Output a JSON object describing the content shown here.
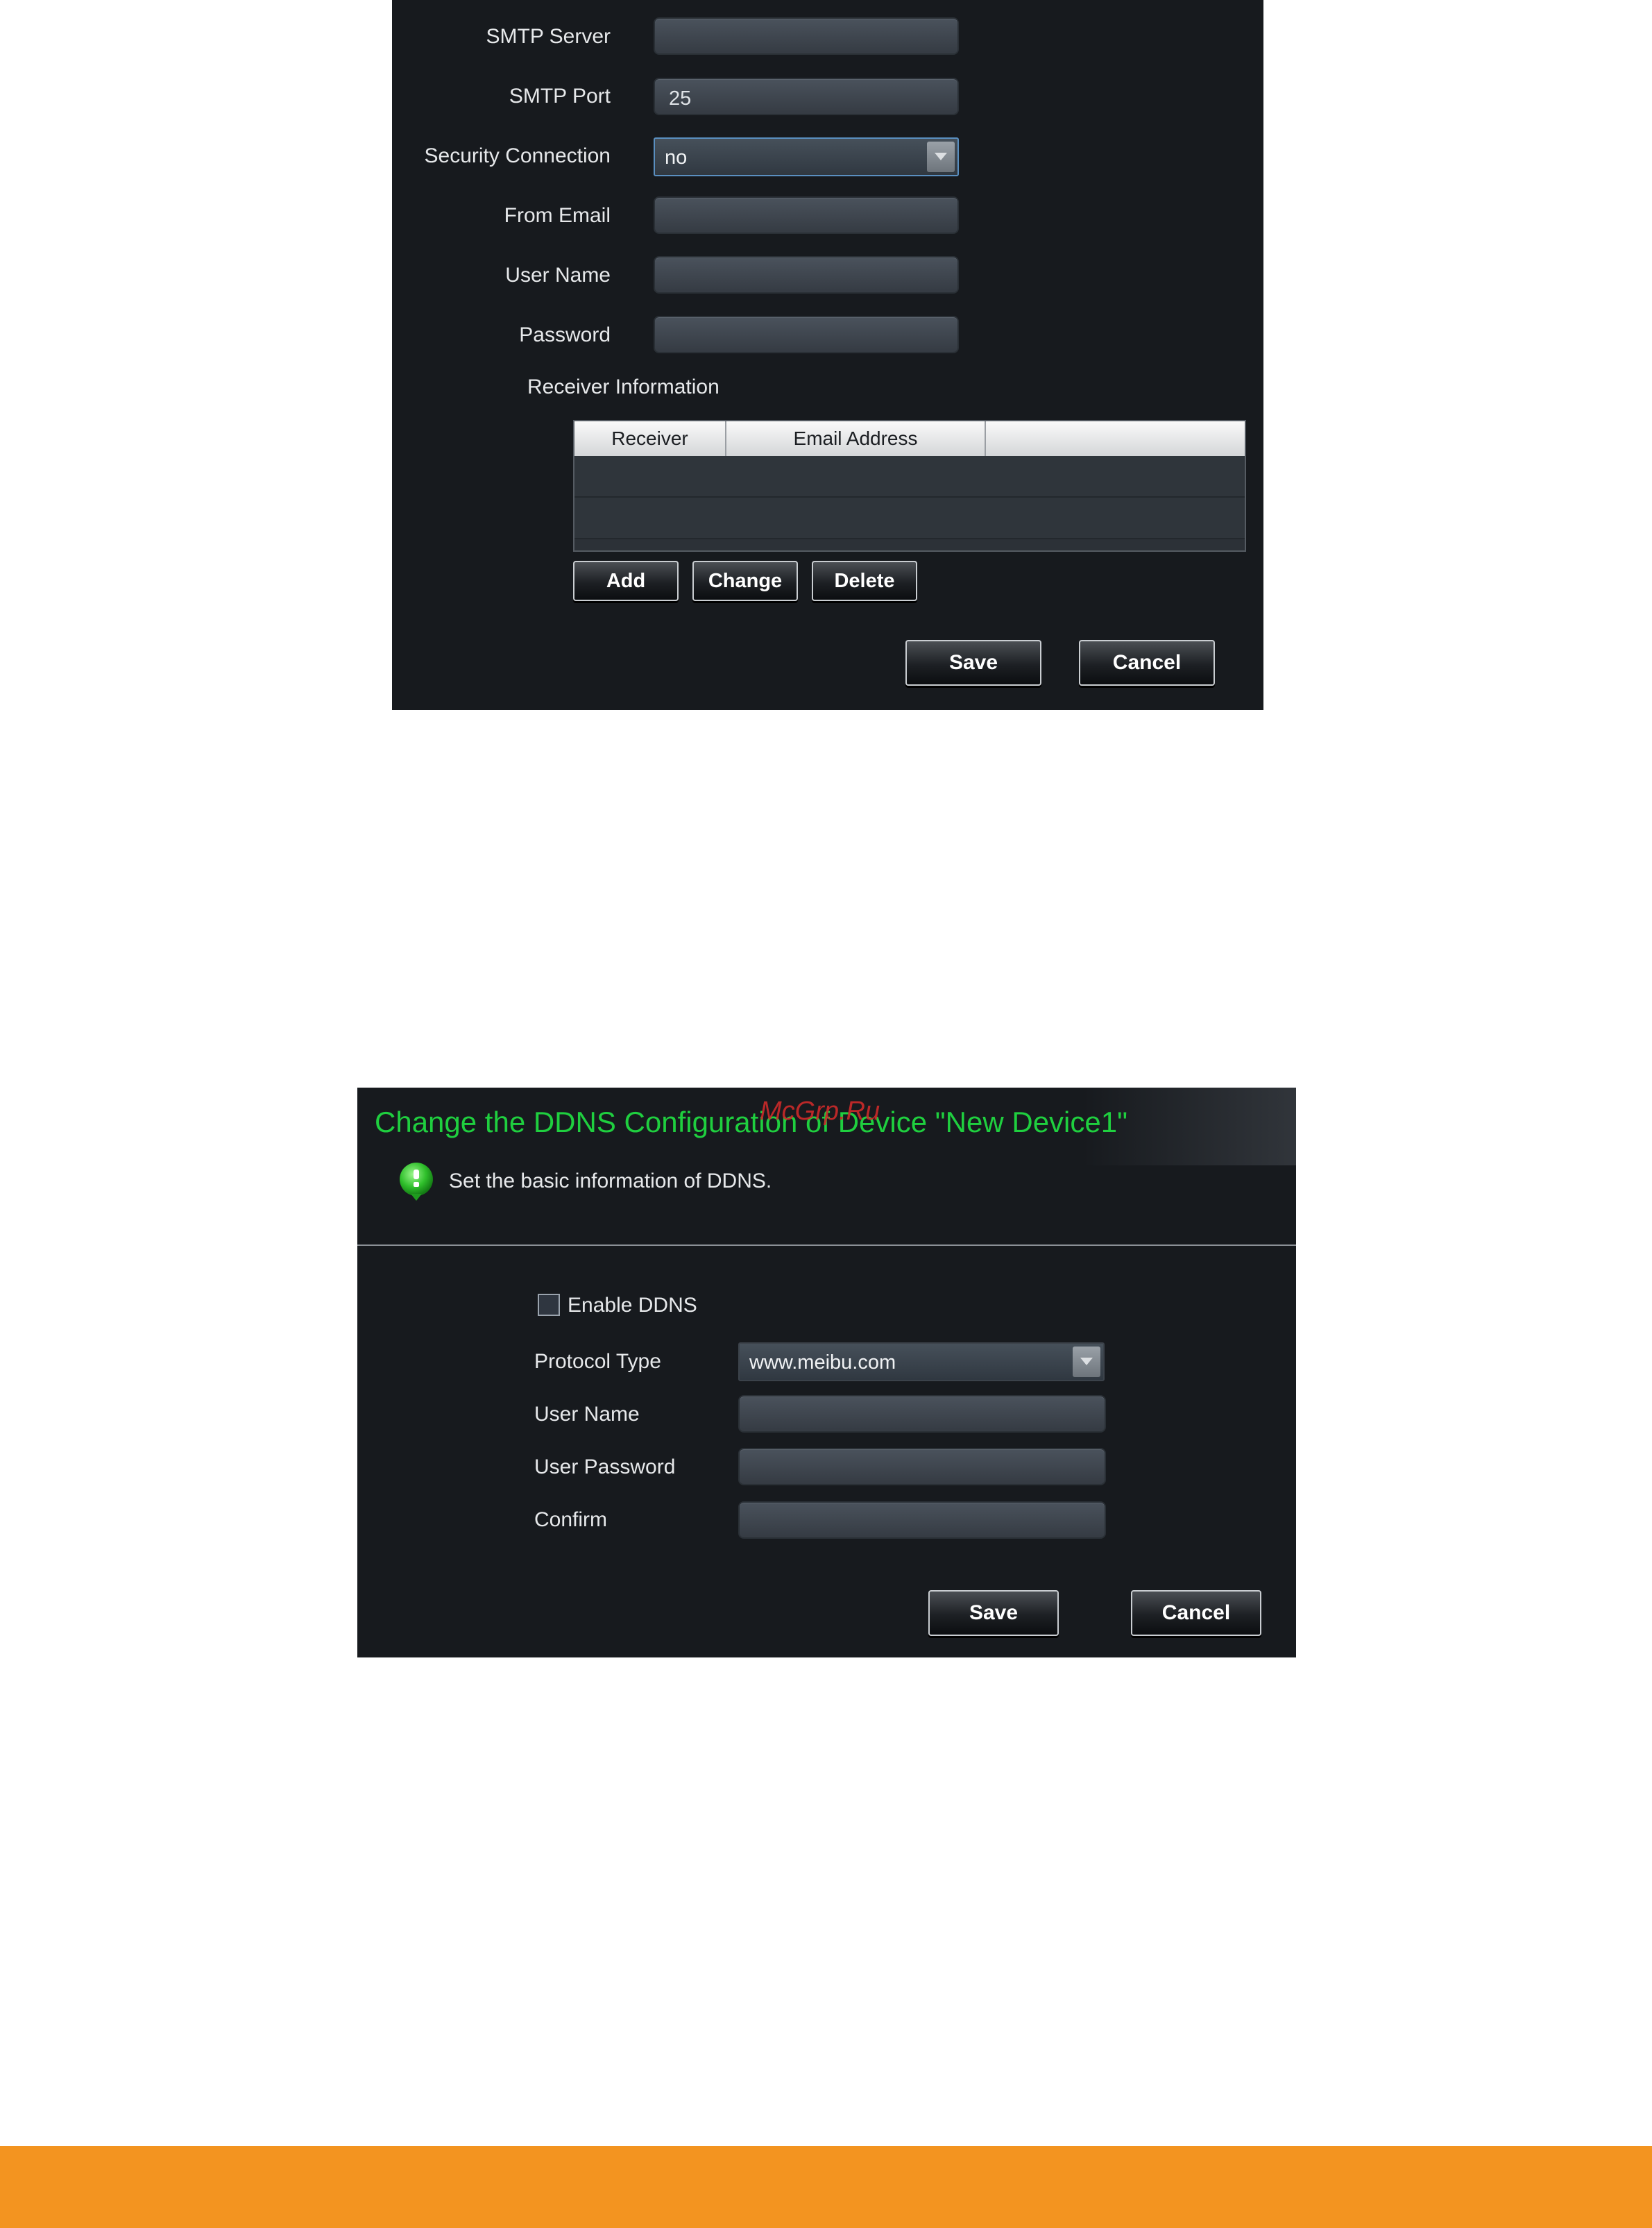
{
  "smtp": {
    "server_label": "SMTP Server",
    "server_value": "",
    "port_label": "SMTP Port",
    "port_value": "25",
    "security_label": "Security Connection",
    "security_value": "no",
    "from_label": "From Email",
    "from_value": "",
    "user_label": "User Name",
    "user_value": "",
    "password_label": "Password",
    "password_value": "",
    "receiver_info_label": "Receiver Information",
    "table": {
      "columns": [
        "Receiver",
        "Email Address",
        ""
      ],
      "rows": []
    },
    "add_label": "Add",
    "change_label": "Change",
    "delete_label": "Delete",
    "save_label": "Save",
    "cancel_label": "Cancel"
  },
  "ddns": {
    "title": "Change the DDNS Configuration of Device \"New Device1\"",
    "watermark": "McGrp.Ru",
    "subtitle": "Set the basic information of DDNS.",
    "enable_label": "Enable DDNS",
    "enable_checked": false,
    "protocol_label": "Protocol Type",
    "protocol_value": "www.meibu.com",
    "user_label": "User Name",
    "user_value": "",
    "password_label": "User Password",
    "password_value": "",
    "confirm_label": "Confirm",
    "confirm_value": "",
    "save_label": "Save",
    "cancel_label": "Cancel"
  },
  "colors": {
    "panel_bg": "#171a1e",
    "title_green": "#1fcf3f",
    "footer_orange": "#f39420",
    "watermark_red": "#cc2a2a"
  },
  "icons": {
    "info": "info-bubble-icon",
    "dropdown": "chevron-down-icon"
  }
}
